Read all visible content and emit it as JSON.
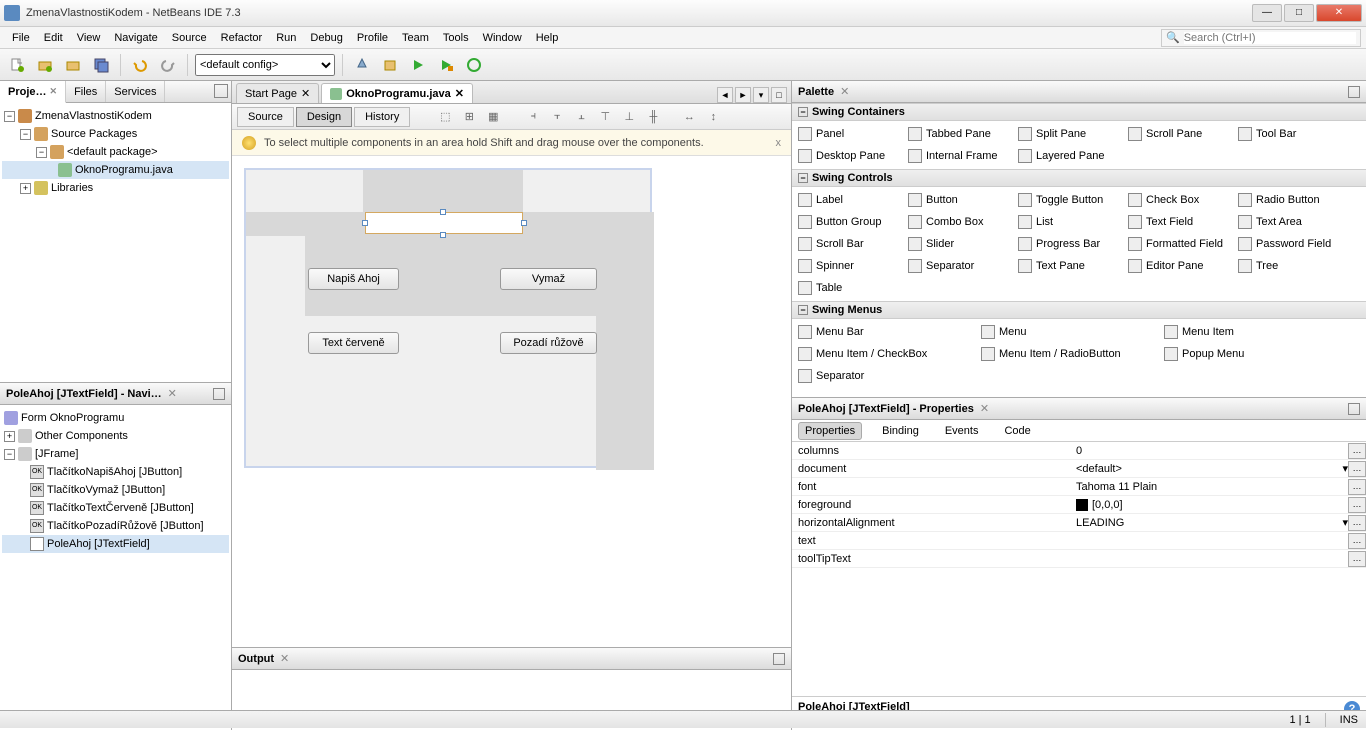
{
  "window": {
    "title": "ZmenaVlastnostiKodem - NetBeans IDE 7.3"
  },
  "menu": {
    "items": [
      "File",
      "Edit",
      "View",
      "Navigate",
      "Source",
      "Refactor",
      "Run",
      "Debug",
      "Profile",
      "Team",
      "Tools",
      "Window",
      "Help"
    ]
  },
  "search": {
    "placeholder": "Search (Ctrl+I)"
  },
  "toolbar": {
    "config": "<default config>"
  },
  "leftTabs": {
    "projects": "Proje…",
    "files": "Files",
    "services": "Services"
  },
  "projectTree": {
    "root": "ZmenaVlastnostiKodem",
    "srcPkg": "Source Packages",
    "defPkg": "<default package>",
    "file": "OknoProgramu.java",
    "libs": "Libraries"
  },
  "navigator": {
    "title": "PoleAhoj [JTextField] - Navi…",
    "form": "Form OknoProgramu",
    "other": "Other Components",
    "jframe": "[JFrame]",
    "items": [
      "TlačítkoNapišAhoj [JButton]",
      "TlačítkoVymaž [JButton]",
      "TlačítkoTextČerveně [JButton]",
      "TlačítkoPozadíRůžově [JButton]",
      "PoleAhoj [JTextField]"
    ]
  },
  "editor": {
    "tabs": {
      "start": "Start Page",
      "file": "OknoProgramu.java"
    },
    "modes": {
      "source": "Source",
      "design": "Design",
      "history": "History"
    },
    "hint": "To select multiple components in an area hold Shift and drag mouse over the components.",
    "buttons": {
      "napis": "Napiš Ahoj",
      "vymaz": "Vymaž",
      "cervene": "Text červeně",
      "ruzove": "Pozadí růžově"
    }
  },
  "output": {
    "title": "Output"
  },
  "palette": {
    "title": "Palette",
    "cats": {
      "containers": "Swing Containers",
      "controls": "Swing Controls",
      "menus": "Swing Menus"
    },
    "containers": [
      "Panel",
      "Tabbed Pane",
      "Split Pane",
      "Scroll Pane",
      "Tool Bar",
      "Desktop Pane",
      "Internal Frame",
      "Layered Pane"
    ],
    "controls": [
      "Label",
      "Button",
      "Toggle Button",
      "Check Box",
      "Radio Button",
      "Button Group",
      "Combo Box",
      "List",
      "Text Field",
      "Text Area",
      "Scroll Bar",
      "Slider",
      "Progress Bar",
      "Formatted Field",
      "Password Field",
      "Spinner",
      "Separator",
      "Text Pane",
      "Editor Pane",
      "Tree",
      "Table"
    ],
    "menus": [
      "Menu Bar",
      "Menu",
      "Menu Item",
      "Menu Item / CheckBox",
      "Menu Item / RadioButton",
      "Popup Menu",
      "Separator"
    ]
  },
  "props": {
    "title": "PoleAhoj [JTextField] - Properties",
    "tabs": {
      "properties": "Properties",
      "binding": "Binding",
      "events": "Events",
      "code": "Code"
    },
    "rows": {
      "columns": {
        "n": "columns",
        "v": "0"
      },
      "document": {
        "n": "document",
        "v": "<default>"
      },
      "font": {
        "n": "font",
        "v": "Tahoma 11 Plain"
      },
      "foreground": {
        "n": "foreground",
        "v": "[0,0,0]"
      },
      "halign": {
        "n": "horizontalAlignment",
        "v": "LEADING"
      },
      "text": {
        "n": "text",
        "v": ""
      },
      "tooltip": {
        "n": "toolTipText",
        "v": ""
      }
    },
    "footer": "PoleAhoj [JTextField]"
  },
  "status": {
    "pos": "1 | 1",
    "ins": "INS"
  }
}
